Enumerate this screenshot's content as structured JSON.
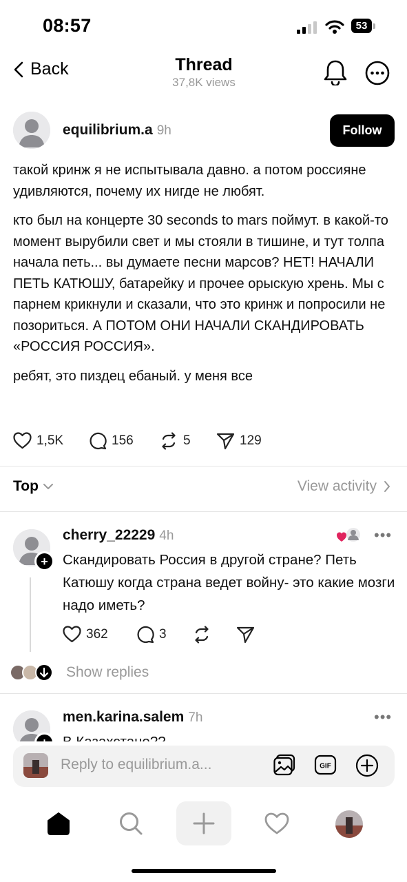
{
  "status_bar": {
    "time": "08:57",
    "battery": "53"
  },
  "header": {
    "back_label": "Back",
    "title": "Thread",
    "views": "37,8K views"
  },
  "post": {
    "username": "equilibrium.a",
    "time_ago": "9h",
    "follow_label": "Follow",
    "paragraphs": [
      "такой кринж я не испытывала давно. а потом россияне удивляются, почему их нигде не любят.",
      "кто был на концерте 30 seconds to mars поймут. в какой-то момент вырубили свет и мы стояли в тишине, и тут толпа начала петь... вы думаете песни марсов? НЕТ! НАЧАЛИ ПЕТЬ КАТЮШУ, батарейку и прочее орыскую хрень. Мы с парнем крикнули и сказали, что это кринж и попросили не позориться. А ПОТОМ ОНИ НАЧАЛИ СКАНДИРОВАТЬ «РОССИЯ РОССИЯ».",
      "ребят, это пиздец ебаный. у меня все"
    ],
    "likes": "1,5K",
    "comments": "156",
    "reposts": "5",
    "shares": "129"
  },
  "sort": {
    "label": "Top",
    "view_activity": "View activity"
  },
  "replies": [
    {
      "username": "cherry_22229",
      "time_ago": "4h",
      "text": "Скандировать Россия в другой стране? Петь Катюшу когда страна ведет войну- это какие мозги надо иметь?",
      "likes": "362",
      "comments": "3",
      "more": "•••"
    },
    {
      "username": "men.karina.salem",
      "time_ago": "7h",
      "text": "В Казахстане??",
      "more": "•••"
    }
  ],
  "show_replies_label": "Show replies",
  "composer": {
    "placeholder": "Reply to equilibrium.a..."
  },
  "colors": {
    "accent_black": "#000000",
    "muted": "#999999",
    "heart_red": "#e0245e"
  }
}
